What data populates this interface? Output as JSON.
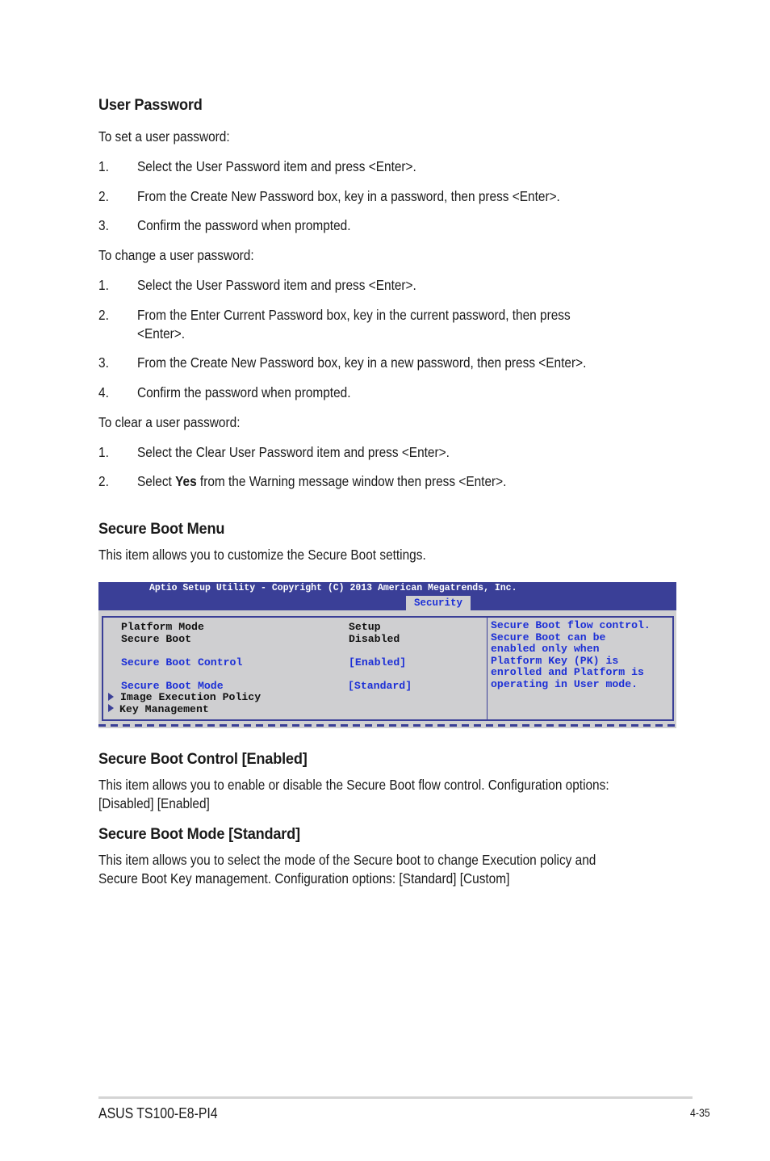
{
  "user_password": {
    "heading": "User Password",
    "set_intro": "To set a user password:",
    "set_steps": [
      {
        "num": "1.",
        "text": "Select the User Password item and press <Enter>."
      },
      {
        "num": "2.",
        "text": "From the Create New Password box, key in a password, then press <Enter>."
      },
      {
        "num": "3.",
        "text": "Confirm the password when prompted."
      }
    ],
    "change_intro": "To change a user password:",
    "change_steps": [
      {
        "num": "1.",
        "text": "Select the User Password item and press <Enter>."
      },
      {
        "num": "2.",
        "text": "From the Enter Current Password box, key in the current password, then press",
        "text_cont": "<Enter>."
      },
      {
        "num": "3.",
        "text": "From the Create New Password box, key in a new password, then press <Enter>."
      },
      {
        "num": "4.",
        "text": "Confirm the password when prompted."
      }
    ],
    "clear_intro": "To clear a user password:",
    "clear_steps": [
      {
        "num": "1.",
        "text": "Select the Clear User Password item and press <Enter>."
      },
      {
        "num": "2.",
        "text_pre": "Select ",
        "text_bold": "Yes",
        "text_post": " from the Warning message window then press <Enter>."
      }
    ]
  },
  "secure_boot_menu": {
    "heading": "Secure Boot Menu",
    "description": "This item allows you to customize the Secure Boot settings."
  },
  "bios": {
    "title": "Aptio Setup Utility - Copyright (C) 2013 American Megatrends, Inc.",
    "active_tab": "Security",
    "items": [
      {
        "label": "Platform Mode",
        "value": "Setup",
        "color": "black"
      },
      {
        "label": "Secure Boot",
        "value": "Disabled",
        "color": "black"
      },
      {
        "label": "Secure Boot Control",
        "value": "[Enabled]",
        "color": "blue"
      },
      {
        "label": "Secure Boot Mode",
        "value": "[Standard]",
        "color": "blue"
      },
      {
        "label": "Image Execution Policy",
        "submenu": true
      },
      {
        "label": "Key Management",
        "submenu": true
      }
    ],
    "help_lines": [
      "Secure Boot flow control.",
      "Secure Boot can be",
      "enabled only when",
      "Platform Key (PK) is",
      "enrolled and Platform is",
      "operating in User mode."
    ],
    "colors": {
      "header": "#3a3f97",
      "body": "#cfcfd1",
      "highlight": "#1c2fd6"
    }
  },
  "secure_boot_control": {
    "heading": "Secure Boot Control [Enabled]",
    "line1": "This item allows you to enable or disable the Secure Boot flow control. Configuration options:",
    "line2": "[Disabled] [Enabled]"
  },
  "secure_boot_mode": {
    "heading": "Secure Boot Mode [Standard]",
    "line1": "This item allows you to select the mode of the Secure boot to change Execution policy and",
    "line2": "Secure Boot Key management. Configuration options: [Standard] [Custom]"
  },
  "footer": {
    "product": "ASUS TS100-E8-PI4",
    "page": "4-35"
  }
}
